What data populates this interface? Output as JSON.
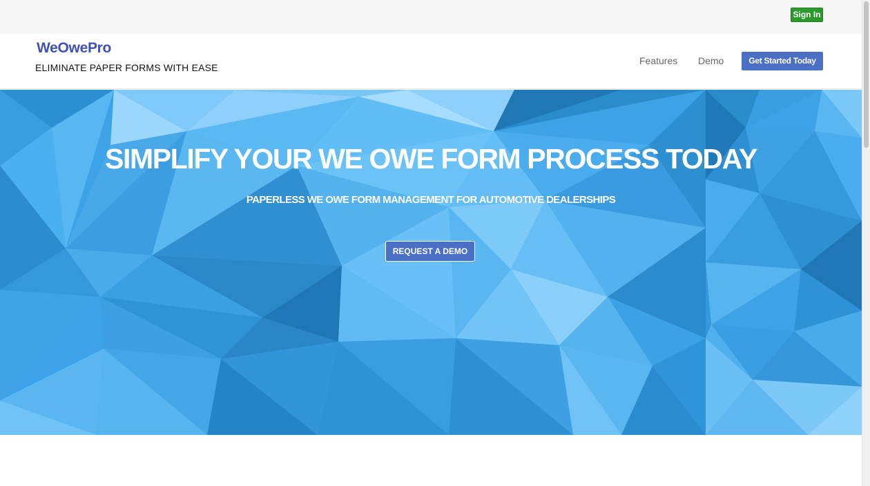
{
  "topbar": {
    "signin_label": "Sign In"
  },
  "header": {
    "brand": "WeOwePro",
    "tagline": "ELIMINATE PAPER FORMS WITH EASE",
    "nav": [
      {
        "label": "Features"
      },
      {
        "label": "Demo"
      }
    ],
    "cta_label": "Get Started Today"
  },
  "hero": {
    "title": "SIMPLIFY YOUR WE OWE FORM PROCESS TODAY",
    "subtitle": "PAPERLESS WE OWE FORM MANAGEMENT FOR AUTOMOTIVE DEALERSHIPS",
    "demo_button": "REQUEST A DEMO"
  },
  "colors": {
    "brand": "#3f51b5",
    "signin": "#2a9b2a",
    "cta": "#4a6fc4",
    "hero_base": "#3ea3e6"
  }
}
